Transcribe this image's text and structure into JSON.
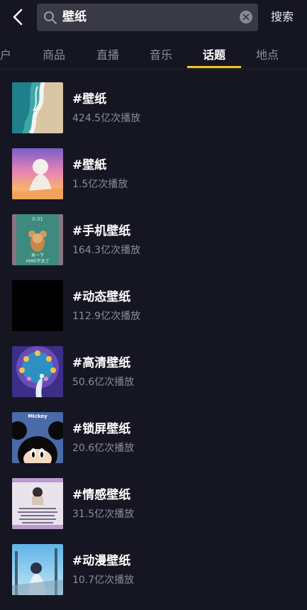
{
  "search": {
    "query": "壁纸",
    "action_label": "搜索"
  },
  "tabs": [
    {
      "label": "户"
    },
    {
      "label": "商品"
    },
    {
      "label": "直播"
    },
    {
      "label": "音乐"
    },
    {
      "label": "话题",
      "active": true
    },
    {
      "label": "地点"
    }
  ],
  "topics": [
    {
      "title": "#壁纸",
      "plays": "424.5亿次播放"
    },
    {
      "title": "#壁紙",
      "plays": "1.5亿次播放"
    },
    {
      "title": "#手机壁纸",
      "plays": "164.3亿次播放"
    },
    {
      "title": "#动态壁纸",
      "plays": "112.9亿次播放"
    },
    {
      "title": "#高清壁纸",
      "plays": "50.6亿次播放"
    },
    {
      "title": "#锁屏壁纸",
      "plays": "20.6亿次播放"
    },
    {
      "title": "#情感壁纸",
      "plays": "31.5亿次播放"
    },
    {
      "title": "#动漫壁纸",
      "plays": "10.7亿次播放"
    }
  ],
  "thumb_texts": {
    "mickey": "Mickey",
    "phone_line1": "来一下",
    "phone_line2": "HIME不太了"
  },
  "colors": {
    "background": "#161622",
    "accent_underline": "#f5c518",
    "secondary_text": "#8d8d98",
    "search_bg": "#3a3a46"
  }
}
